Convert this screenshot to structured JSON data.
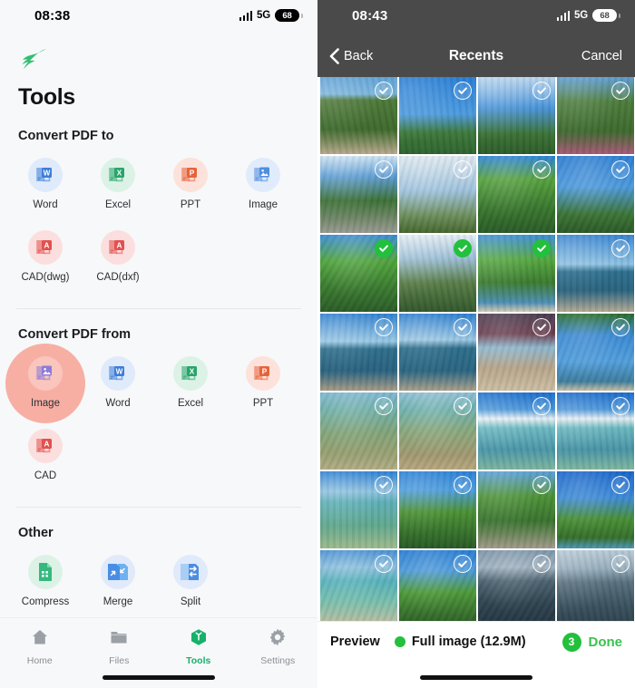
{
  "left": {
    "status": {
      "time": "08:38",
      "network": "5G",
      "battery": "68",
      "signal_icon": "signal-bars-icon"
    },
    "logo_icon": "swallow-logo-icon",
    "page_title": "Tools",
    "sections": [
      {
        "title": "Convert PDF to",
        "items": [
          {
            "label": "Word",
            "icon": "word-file-icon",
            "badge": "W",
            "color": "#3D7DD8",
            "bg": "#dfeafb",
            "highlighted": false
          },
          {
            "label": "Excel",
            "icon": "excel-file-icon",
            "badge": "X",
            "color": "#28a56b",
            "bg": "#dcf2e6",
            "highlighted": false
          },
          {
            "label": "PPT",
            "icon": "ppt-file-icon",
            "badge": "P",
            "color": "#e6633a",
            "bg": "#fce2da",
            "highlighted": false
          },
          {
            "label": "Image",
            "icon": "image-file-icon",
            "badge": "IMG",
            "color": "#4e8ee0",
            "bg": "#e0ebfb",
            "highlighted": false
          },
          {
            "label": "CAD(dwg)",
            "icon": "cad-file-icon",
            "badge": "A",
            "color": "#e2514e",
            "bg": "#fbdfde",
            "highlighted": false
          },
          {
            "label": "CAD(dxf)",
            "icon": "cad-file-icon",
            "badge": "A",
            "color": "#e2514e",
            "bg": "#fbdfde",
            "highlighted": false
          }
        ]
      },
      {
        "title": "Convert PDF from",
        "items": [
          {
            "label": "Image",
            "icon": "image-file-icon",
            "badge": "IMG",
            "color": "#8e7ad6",
            "bg": "#e7e2f7",
            "highlighted": true
          },
          {
            "label": "Word",
            "icon": "word-file-icon",
            "badge": "W",
            "color": "#3D7DD8",
            "bg": "#dfeafb",
            "highlighted": false
          },
          {
            "label": "Excel",
            "icon": "excel-file-icon",
            "badge": "X",
            "color": "#28a56b",
            "bg": "#dcf2e6",
            "highlighted": false
          },
          {
            "label": "PPT",
            "icon": "ppt-file-icon",
            "badge": "P",
            "color": "#e6633a",
            "bg": "#fce2da",
            "highlighted": false
          },
          {
            "label": "CAD",
            "icon": "cad-file-icon",
            "badge": "A",
            "color": "#e2514e",
            "bg": "#fbdfde",
            "highlighted": false
          }
        ]
      },
      {
        "title": "Other",
        "items": [
          {
            "label": "Compress",
            "icon": "compress-icon",
            "badge": "",
            "color": "#35b97f",
            "bg": "#dcf2e6",
            "highlighted": false
          },
          {
            "label": "Merge",
            "icon": "merge-icon",
            "badge": "",
            "color": "#4a8ee3",
            "bg": "#e0eafb",
            "highlighted": false
          },
          {
            "label": "Split",
            "icon": "split-icon",
            "badge": "",
            "color": "#4a8ee3",
            "bg": "#e0eafb",
            "highlighted": false
          }
        ]
      }
    ],
    "tabs": [
      {
        "label": "Home",
        "icon": "home-icon",
        "active": false
      },
      {
        "label": "Files",
        "icon": "folder-icon",
        "active": false
      },
      {
        "label": "Tools",
        "icon": "cube-icon",
        "active": true
      },
      {
        "label": "Settings",
        "icon": "gear-icon",
        "active": false
      }
    ],
    "accent": "#18b06a",
    "highlight_color": "#f7afa4"
  },
  "right": {
    "status": {
      "time": "08:43",
      "network": "5G",
      "battery": "68",
      "signal_icon": "signal-bars-icon"
    },
    "nav": {
      "back_label": "Back",
      "back_icon": "chevron-left-icon",
      "title": "Recents",
      "cancel_label": "Cancel"
    },
    "grid": {
      "columns": 4,
      "cells": [
        {
          "scene": "palms-house",
          "selected": false
        },
        {
          "scene": "palm-blue-sky",
          "selected": false
        },
        {
          "scene": "palm-canopy-sun",
          "selected": false
        },
        {
          "scene": "palm-grove-pink",
          "selected": false
        },
        {
          "scene": "road-trees",
          "selected": false
        },
        {
          "scene": "bare-tree-sky",
          "selected": false
        },
        {
          "scene": "palm-fronds-lit",
          "selected": false
        },
        {
          "scene": "palms-upward",
          "selected": false
        },
        {
          "scene": "palm-trunk-green",
          "selected": true
        },
        {
          "scene": "palms-sunflare",
          "selected": true
        },
        {
          "scene": "palms-seaside",
          "selected": true
        },
        {
          "scene": "seawall-ocean",
          "selected": false
        },
        {
          "scene": "seawall-fence-a",
          "selected": false
        },
        {
          "scene": "seawall-fence-b",
          "selected": false
        },
        {
          "scene": "beach-hut",
          "selected": false
        },
        {
          "scene": "palm-edge-sea",
          "selected": false
        },
        {
          "scene": "shallow-reef-a",
          "selected": false
        },
        {
          "scene": "shallow-rocks",
          "selected": false
        },
        {
          "scene": "lagoon-horizon-a",
          "selected": false
        },
        {
          "scene": "lagoon-horizon-b",
          "selected": false
        },
        {
          "scene": "clear-lagoon",
          "selected": false
        },
        {
          "scene": "coconut-palm",
          "selected": false
        },
        {
          "scene": "palm-avenue",
          "selected": false
        },
        {
          "scene": "palm-row-sea",
          "selected": false
        },
        {
          "scene": "turquoise-shore",
          "selected": false
        },
        {
          "scene": "palms-backlit",
          "selected": false
        },
        {
          "scene": "dark-rocky-sea",
          "selected": false
        },
        {
          "scene": "sunlit-rocky-sea",
          "selected": false
        }
      ]
    },
    "bottom": {
      "preview_label": "Preview",
      "full_image_label": "Full image (12.9M)",
      "full_image_selected": true,
      "selected_count": "3",
      "done_label": "Done",
      "accent": "#22c03c"
    }
  }
}
